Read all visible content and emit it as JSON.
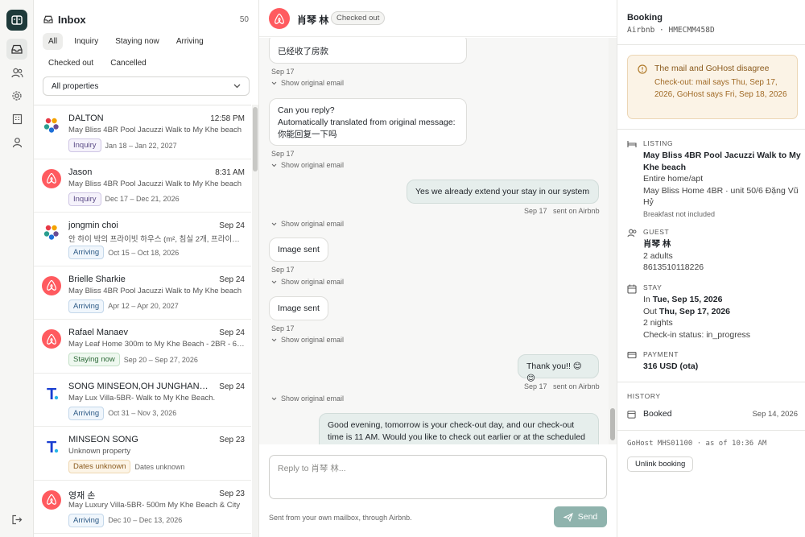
{
  "inbox": {
    "title": "Inbox",
    "count": "50",
    "filters": [
      "All",
      "Inquiry",
      "Staying now",
      "Arriving",
      "Checked out",
      "Cancelled"
    ],
    "property_select": "All properties",
    "items": [
      {
        "name": "DALTON",
        "date": "12:58 PM",
        "sub": "May Bliss 4BR Pool Jacuzzi Walk to My Khe beach",
        "badge": "Inquiry",
        "range": "Jan 18 – Jan 22, 2027",
        "avatar": "agoda-icon"
      },
      {
        "name": "Jason",
        "date": "8:31 AM",
        "sub": "May Bliss 4BR Pool Jacuzzi Walk to My Khe beach",
        "badge": "Inquiry",
        "range": "Dec 17 – Dec 21, 2026",
        "avatar": "airbnb-icon"
      },
      {
        "name": "jongmin choi",
        "date": "Sep 24",
        "sub": "안 하이 박의 프라이빗 하우스 (m², 침실 2개, 프라이빗 욕실 ...",
        "badge": "Arriving",
        "range": "Oct 15 – Oct 18, 2026",
        "avatar": "agoda-icon"
      },
      {
        "name": "Brielle Sharkie",
        "date": "Sep 24",
        "sub": "May Bliss 4BR Pool Jacuzzi Walk to My Khe beach",
        "badge": "Arriving",
        "range": "Apr 12 – Apr 20, 2027",
        "avatar": "airbnb-icon"
      },
      {
        "name": "Rafael Manaev",
        "date": "Sep 24",
        "sub": "May Leaf Home 300m to My Khe Beach - 2BR - 6p...",
        "badge": "Staying now",
        "range": "Sep 20 – Sep 27, 2026",
        "avatar": "airbnb-icon"
      },
      {
        "name": "SONG MINSEON,OH JUNGHAN,KIM...",
        "date": "Sep 24",
        "sub": "May Lux Villa-5BR- Walk to My Khe Beach.",
        "badge": "Arriving",
        "range": "Oct 31 – Nov 3, 2026",
        "avatar": "traveloka-icon"
      },
      {
        "name": "MINSEON SONG",
        "date": "Sep 23",
        "sub": "Unknown property",
        "badge": "Dates unknown",
        "range": "Dates unknown",
        "avatar": "traveloka-icon"
      },
      {
        "name": "영재 손",
        "date": "Sep 23",
        "sub": "May Luxury Villa-5BR- 500m My Khe Beach & City",
        "badge": "Arriving",
        "range": "Dec 10 – Dec 13, 2026",
        "avatar": "airbnb-icon"
      }
    ]
  },
  "conversation": {
    "guest_name": "肖琴 林",
    "status": "Checked out",
    "messages": [
      {
        "text": "已经收了房款",
        "dir": "in",
        "meta": "Sep 17"
      },
      {
        "text": "Can you reply?\nAutomatically translated from original message:\n你能回复一下吗",
        "dir": "in",
        "meta": "Sep 17"
      },
      {
        "text": "Yes we already extend your stay in our system",
        "dir": "out",
        "meta": "Sep 17   sent on Airbnb"
      },
      {
        "text": "Image sent",
        "dir": "in",
        "meta": "Sep 17"
      },
      {
        "text": "Image sent",
        "dir": "in",
        "meta": "Sep 17"
      },
      {
        "text": "Thank you!! 😊😊",
        "dir": "out",
        "meta": "Sep 17   sent on Airbnb"
      },
      {
        "text": "Good evening, tomorrow is your check-out day, and our check-out time is 11 AM. Would you like to check out earlier or at the scheduled",
        "dir": "out",
        "meta": ""
      }
    ],
    "show_original": "Show original email",
    "composer_placeholder": "Reply to 肖琴 林...",
    "footnote": "Sent from your own mailbox, through Airbnb.",
    "send_label": "Send"
  },
  "booking": {
    "title": "Booking",
    "subtitle": "Airbnb · HMECMM458D",
    "warning_title": "The mail and GoHost disagree",
    "warning_body": "Check-out: mail says Thu, Sep 17, 2026, GoHost says Fri, Sep 18, 2026",
    "listing_label": "LISTING",
    "listing_name": "May Bliss 4BR Pool Jacuzzi Walk to My Khe beach",
    "listing_type": "Entire home/apt",
    "listing_unit": "May Bliss Home 4BR · unit 50/6 Đặng Vũ Hỷ",
    "listing_breakfast": "Breakfast not included",
    "guest_label": "GUEST",
    "guest_name": "肖琴 林",
    "guest_count": "2 adults",
    "guest_phone": "8613510118226",
    "stay_label": "STAY",
    "stay_in_prefix": "In",
    "stay_in": "Tue, Sep 15, 2026",
    "stay_out_prefix": "Out",
    "stay_out": "Thu, Sep 17, 2026",
    "stay_nights": "2 nights",
    "stay_checkin": "Check-in status: in_progress",
    "payment_label": "PAYMENT",
    "payment_value": "316 USD (ota)",
    "history_label": "HISTORY",
    "history_event": "Booked",
    "history_date": "Sep 14, 2026",
    "gohost": "GoHost MHS01100 · as of 10:36 AM",
    "unlink_label": "Unlink booking"
  },
  "colors": {
    "airbnb": "#ff5a5f",
    "accent": "#1e3a3a",
    "send": "#8fb3ad",
    "warning_bg": "#fbf3e6"
  }
}
